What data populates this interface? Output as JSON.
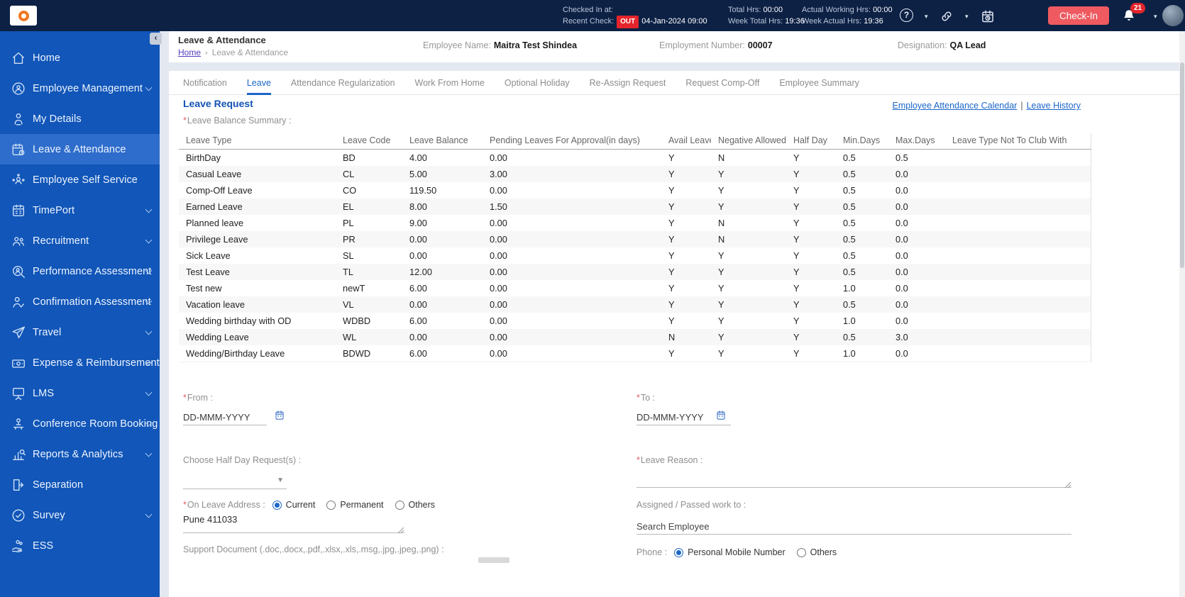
{
  "topbar": {
    "checked_in_at_label": "Checked In at:",
    "recent_check_label": "Recent Check:",
    "out_badge": "OUT",
    "recent_check_value": "04-Jan-2024 09:00",
    "total_hrs_label": "Total Hrs:",
    "total_hrs_value": "00:00",
    "week_total_hrs_label": "Week Total Hrs:",
    "week_total_hrs_value": "19:36",
    "actual_working_hrs_label": "Actual Working Hrs:",
    "actual_working_hrs_value": "00:00",
    "week_actual_hrs_label": "Week Actual Hrs:",
    "week_actual_hrs_value": "19:36",
    "checkin_button_label": "Check-In",
    "notification_count": "21",
    "icons": [
      "help-icon",
      "link-icon",
      "calendar-clock-icon",
      "bell-icon",
      "user-avatar"
    ]
  },
  "sidebar": {
    "collapse_icon": "‹",
    "items": [
      {
        "label": "Home",
        "icon": "home-icon",
        "chevron": false,
        "active": false
      },
      {
        "label": "Employee Management",
        "icon": "employee-management-icon",
        "chevron": true,
        "active": false
      },
      {
        "label": "My Details",
        "icon": "my-details-icon",
        "chevron": false,
        "active": false
      },
      {
        "label": "Leave & Attendance",
        "icon": "leave-attendance-icon",
        "chevron": false,
        "active": true
      },
      {
        "label": "Employee Self Service",
        "icon": "employee-self-service-icon",
        "chevron": false,
        "active": false
      },
      {
        "label": "TimePort",
        "icon": "timeport-icon",
        "chevron": true,
        "active": false
      },
      {
        "label": "Recruitment",
        "icon": "recruitment-icon",
        "chevron": true,
        "active": false
      },
      {
        "label": "Performance Assessment",
        "icon": "performance-assessment-icon",
        "chevron": true,
        "active": false
      },
      {
        "label": "Confirmation Assessment",
        "icon": "confirmation-assessment-icon",
        "chevron": true,
        "active": false
      },
      {
        "label": "Travel",
        "icon": "travel-icon",
        "chevron": true,
        "active": false
      },
      {
        "label": "Expense & Reimbursement",
        "icon": "expense-reimbursement-icon",
        "chevron": true,
        "active": false
      },
      {
        "label": "LMS",
        "icon": "lms-icon",
        "chevron": true,
        "active": false
      },
      {
        "label": "Conference Room Booking",
        "icon": "conference-room-booking-icon",
        "chevron": true,
        "active": false
      },
      {
        "label": "Reports & Analytics",
        "icon": "reports-analytics-icon",
        "chevron": true,
        "active": false
      },
      {
        "label": "Separation",
        "icon": "separation-icon",
        "chevron": false,
        "active": false
      },
      {
        "label": "Survey",
        "icon": "survey-icon",
        "chevron": true,
        "active": false
      },
      {
        "label": "ESS",
        "icon": "ess-icon",
        "chevron": false,
        "active": false
      }
    ]
  },
  "header": {
    "title": "Leave & Attendance",
    "breadcrumb_home": "Home",
    "breadcrumb_separator": "›",
    "breadcrumb_current": "Leave & Attendance",
    "employee_name_label": "Employee Name:",
    "employee_name": "Maitra Test Shindea",
    "employment_number_label": "Employment Number:",
    "employment_number": "00007",
    "designation_label": "Designation:",
    "designation": "QA Lead"
  },
  "tabs": [
    {
      "label": "Notification",
      "active": false
    },
    {
      "label": "Leave",
      "active": true
    },
    {
      "label": "Attendance Regularization",
      "active": false
    },
    {
      "label": "Work From Home",
      "active": false
    },
    {
      "label": "Optional Holiday",
      "active": false
    },
    {
      "label": "Re-Assign Request",
      "active": false
    },
    {
      "label": "Request Comp-Off",
      "active": false
    },
    {
      "label": "Employee Summary",
      "active": false
    }
  ],
  "leave": {
    "section_title": "Leave Request",
    "link_calendar": "Employee Attendance Calendar",
    "link_separator": "|",
    "link_history": "Leave History",
    "required_mark": "*",
    "balance_summary_label": "Leave Balance Summary :",
    "table": {
      "columns": [
        "Leave Type",
        "Leave Code",
        "Leave Balance",
        "Pending Leaves For Approval(in days)",
        "Avail Leave",
        "Negative Allowed",
        "Half Day",
        "Min.Days",
        "Max.Days",
        "Leave Type Not To Club With"
      ],
      "rows": [
        [
          "BirthDay",
          "BD",
          "4.00",
          "0.00",
          "Y",
          "N",
          "Y",
          "0.5",
          "0.5",
          ""
        ],
        [
          "Casual Leave",
          "CL",
          "5.00",
          "3.00",
          "Y",
          "Y",
          "Y",
          "0.5",
          "0.0",
          ""
        ],
        [
          "Comp-Off Leave",
          "CO",
          "119.50",
          "0.00",
          "Y",
          "Y",
          "Y",
          "0.5",
          "0.0",
          ""
        ],
        [
          "Earned Leave",
          "EL",
          "8.00",
          "1.50",
          "Y",
          "Y",
          "Y",
          "0.5",
          "0.0",
          ""
        ],
        [
          "Planned leave",
          "PL",
          "9.00",
          "0.00",
          "Y",
          "N",
          "Y",
          "0.5",
          "0.0",
          ""
        ],
        [
          "Privilege Leave",
          "PR",
          "0.00",
          "0.00",
          "Y",
          "N",
          "Y",
          "0.5",
          "0.0",
          ""
        ],
        [
          "Sick Leave",
          "SL",
          "0.00",
          "0.00",
          "Y",
          "Y",
          "Y",
          "0.5",
          "0.0",
          ""
        ],
        [
          "Test Leave",
          "TL",
          "12.00",
          "0.00",
          "Y",
          "Y",
          "Y",
          "0.5",
          "0.0",
          ""
        ],
        [
          "Test new",
          "newT",
          "6.00",
          "0.00",
          "Y",
          "Y",
          "Y",
          "1.0",
          "0.0",
          ""
        ],
        [
          "Vacation leave",
          "VL",
          "0.00",
          "0.00",
          "Y",
          "Y",
          "Y",
          "0.5",
          "0.0",
          ""
        ],
        [
          "Wedding birthday with OD",
          "WDBD",
          "6.00",
          "0.00",
          "Y",
          "Y",
          "Y",
          "1.0",
          "0.0",
          ""
        ],
        [
          "Wedding Leave",
          "WL",
          "0.00",
          "0.00",
          "N",
          "Y",
          "Y",
          "0.5",
          "3.0",
          ""
        ],
        [
          "Wedding/Birthday Leave",
          "BDWD",
          "6.00",
          "0.00",
          "Y",
          "Y",
          "Y",
          "1.0",
          "0.0",
          ""
        ]
      ]
    },
    "form": {
      "from_label": "From :",
      "from_placeholder": "DD-MMM-YYYY",
      "to_label": "To :",
      "to_placeholder": "DD-MMM-YYYY",
      "half_day_label": "Choose Half Day Request(s) :",
      "leave_reason_label": "Leave Reason :",
      "on_leave_address_label": "On Leave Address :",
      "address_options": [
        "Current",
        "Permanent",
        "Others"
      ],
      "address_selected": "Current",
      "address_value": "Pune 411033",
      "assigned_label": "Assigned / Passed work to :",
      "assigned_placeholder": "Search Employee",
      "support_doc_label": "Support Document (.doc,.docx,.pdf,.xlsx,.xls,.msg,.jpg,.jpeg,.png) :",
      "phone_label": "Phone :",
      "phone_options": [
        "Personal Mobile Number",
        "Others"
      ],
      "phone_selected": "Personal Mobile Number"
    }
  },
  "colors": {
    "topbar_bg": "#0d2145",
    "sidebar_bg": "#1156b8",
    "sidebar_active_bg": "#2e6dcb",
    "accent_blue": "#1b66c9",
    "section_title_blue": "#1353b5",
    "danger_red": "#e4252b",
    "checkin_red": "#ee5a60"
  }
}
